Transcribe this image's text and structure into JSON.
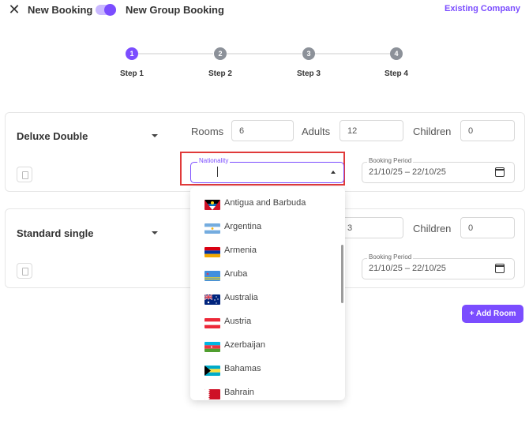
{
  "header": {
    "new_booking": "New Booking",
    "new_group_booking": "New Group Booking",
    "existing_company": "Existing Company"
  },
  "toggle": {
    "on": true
  },
  "colors": {
    "accent": "#7b4dff",
    "highlight": "#e03a3a"
  },
  "steps": [
    {
      "number": "1",
      "label": "Step 1",
      "active": true
    },
    {
      "number": "2",
      "label": "Step 2",
      "active": false
    },
    {
      "number": "3",
      "label": "Step 3",
      "active": false
    },
    {
      "number": "4",
      "label": "Step 4",
      "active": false
    }
  ],
  "rooms": [
    {
      "name": "Deluxe Double",
      "rooms_label": "Rooms",
      "rooms_value": "6",
      "adults_label": "Adults",
      "adults_value": "12",
      "children_label": "Children",
      "children_value": "0",
      "nationality_label": "Nationality",
      "nationality_value": "",
      "booking_period_label": "Booking Period",
      "booking_period_value": "21/10/25 – 22/10/25"
    },
    {
      "name": "Standard single",
      "adults_value": "3",
      "children_label": "Children",
      "children_value": "0",
      "booking_period_label": "Booking Period",
      "booking_period_value": "21/10/25 – 22/10/25"
    }
  ],
  "nationality_options": [
    {
      "label": "Antigua and Barbuda",
      "flag": "antigua-barbuda"
    },
    {
      "label": "Argentina",
      "flag": "argentina"
    },
    {
      "label": "Armenia",
      "flag": "armenia"
    },
    {
      "label": "Aruba",
      "flag": "aruba"
    },
    {
      "label": "Australia",
      "flag": "australia"
    },
    {
      "label": "Austria",
      "flag": "austria"
    },
    {
      "label": "Azerbaijan",
      "flag": "azerbaijan"
    },
    {
      "label": "Bahamas",
      "flag": "bahamas"
    },
    {
      "label": "Bahrain",
      "flag": "bahrain"
    }
  ],
  "add_room_label": "+ Add Room"
}
